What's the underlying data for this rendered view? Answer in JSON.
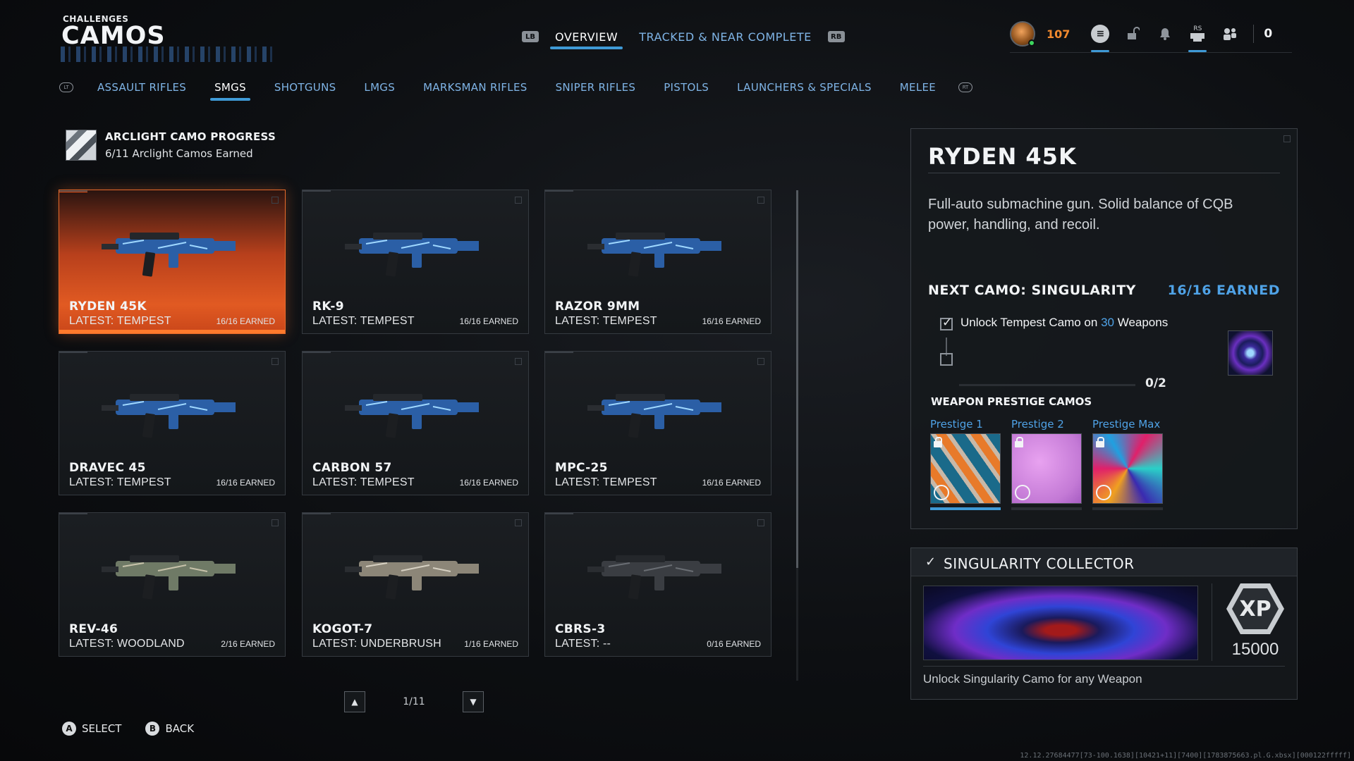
{
  "header": {
    "subtitle": "CHALLENGES",
    "title": "CAMOS"
  },
  "top_tabs": {
    "left_bumper": "LB",
    "right_bumper": "RB",
    "items": [
      {
        "label": "OVERVIEW",
        "active": true
      },
      {
        "label": "TRACKED & NEAR COMPLETE",
        "active": false
      }
    ]
  },
  "player": {
    "level": "107",
    "rs_label": "RS",
    "count": "0"
  },
  "categories": {
    "items": [
      {
        "label": "ASSAULT RIFLES",
        "active": false
      },
      {
        "label": "SMGS",
        "active": true
      },
      {
        "label": "SHOTGUNS",
        "active": false
      },
      {
        "label": "LMGS",
        "active": false
      },
      {
        "label": "MARKSMAN RIFLES",
        "active": false
      },
      {
        "label": "SNIPER RIFLES",
        "active": false
      },
      {
        "label": "PISTOLS",
        "active": false
      },
      {
        "label": "LAUNCHERS & SPECIALS",
        "active": false
      },
      {
        "label": "MELEE",
        "active": false
      }
    ]
  },
  "arclight": {
    "title": "ARCLIGHT CAMO PROGRESS",
    "subtitle": "6/11 Arclight Camos Earned"
  },
  "weapons": [
    {
      "name": "RYDEN 45K",
      "latest": "LATEST: TEMPEST",
      "earned": "16/16 EARNED",
      "selected": true,
      "camo": "tempest"
    },
    {
      "name": "RK-9",
      "latest": "LATEST: TEMPEST",
      "earned": "16/16 EARNED",
      "selected": false,
      "camo": "tempest"
    },
    {
      "name": "RAZOR 9MM",
      "latest": "LATEST: TEMPEST",
      "earned": "16/16 EARNED",
      "selected": false,
      "camo": "tempest"
    },
    {
      "name": "DRAVEC 45",
      "latest": "LATEST: TEMPEST",
      "earned": "16/16 EARNED",
      "selected": false,
      "camo": "tempest"
    },
    {
      "name": "CARBON 57",
      "latest": "LATEST: TEMPEST",
      "earned": "16/16 EARNED",
      "selected": false,
      "camo": "tempest"
    },
    {
      "name": "MPC-25",
      "latest": "LATEST: TEMPEST",
      "earned": "16/16 EARNED",
      "selected": false,
      "camo": "tempest"
    },
    {
      "name": "REV-46",
      "latest": "LATEST: WOODLAND",
      "earned": "2/16 EARNED",
      "selected": false,
      "camo": "woodland"
    },
    {
      "name": "KOGOT-7",
      "latest": "LATEST: UNDERBRUSH",
      "earned": "1/16 EARNED",
      "selected": false,
      "camo": "underbrush"
    },
    {
      "name": "CBRS-3",
      "latest": "LATEST: --",
      "earned": "0/16 EARNED",
      "selected": false,
      "camo": "none"
    }
  ],
  "pager": {
    "page": "1/11"
  },
  "legend": {
    "select_btn": "A",
    "select_label": "SELECT",
    "back_btn": "B",
    "back_label": "BACK"
  },
  "detail": {
    "title": "RYDEN 45K",
    "description": "Full-auto submachine gun. Solid balance of CQB power, handling, and recoil.",
    "next_camo": "NEXT CAMO: SINGULARITY",
    "earned": "16/16 EARNED",
    "requirement_prefix": "Unlock Tempest Camo on ",
    "requirement_num": "30",
    "requirement_suffix": " Weapons",
    "progress": "0/2",
    "progress_fraction": 0,
    "prestige_title": "WEAPON PRESTIGE CAMOS",
    "prestige": [
      {
        "label": "Prestige 1",
        "locked": true,
        "fill": 1.0
      },
      {
        "label": "Prestige 2",
        "locked": true,
        "fill": 0
      },
      {
        "label": "Prestige Max",
        "locked": true,
        "fill": 0
      }
    ]
  },
  "collector": {
    "title": "SINGULARITY COLLECTOR",
    "xp_label": "XP",
    "xp": "15000",
    "description": "Unlock Singularity Camo for any Weapon"
  },
  "debug": "12.12.27684477[73-100.1638][10421+11][7400][1783875663.pl.G.xbsx][000122fffff]",
  "colors": {
    "accent": "#3f9ad6",
    "selected": "#e15a22",
    "link": "#4fa2e6",
    "level": "#f28a2e"
  }
}
